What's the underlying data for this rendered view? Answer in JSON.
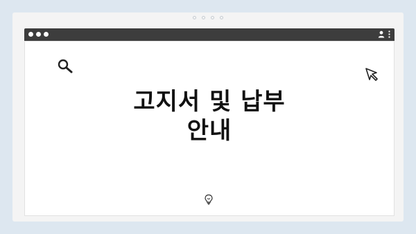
{
  "window": {
    "title_lines": [
      "고지서 및 납부",
      "안내"
    ]
  },
  "pager": {
    "count": 4
  },
  "icons": {
    "search": "search-icon",
    "cursor": "cursor-icon",
    "bulb": "lightbulb-icon",
    "user": "user-icon",
    "more": "more-vertical-icon"
  }
}
